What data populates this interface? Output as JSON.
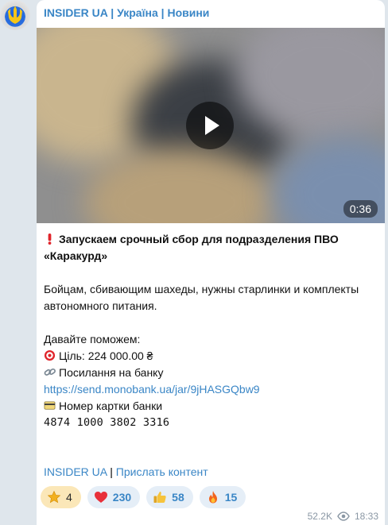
{
  "channel": {
    "name": "INSIDER UA | Україна | Новини"
  },
  "video": {
    "duration": "0:36"
  },
  "post": {
    "headline": "Запускаем срочный сбор для подразделения ПВО «Каракурд»",
    "para1": "Бойцам, сбивающим шахеды, нужны старлинки и комплекты автономного питания.",
    "help": "Давайте поможем:",
    "goal": "Ціль: 224 000.00 ₴",
    "bank_link_label": "Посилання на банку",
    "bank_url": "https://send.monobank.ua/jar/9jHASGQbw9",
    "card_label": "Номер картки банки",
    "card_number": "4874 1000 3802 3316"
  },
  "footer": {
    "channel_link": "INSIDER UA",
    "separator": "|",
    "submit_link": "Прислать контент"
  },
  "reactions": [
    {
      "icon": "star-icon",
      "count": "4"
    },
    {
      "icon": "heart-icon",
      "count": "230"
    },
    {
      "icon": "thumbs-up-icon",
      "count": "58"
    },
    {
      "icon": "fire-icon",
      "count": "15"
    }
  ],
  "meta": {
    "views": "52.2K",
    "time": "18:33"
  },
  "colors": {
    "accent": "#3a86c6",
    "background": "#dfe6ec",
    "bubble": "#ffffff"
  }
}
